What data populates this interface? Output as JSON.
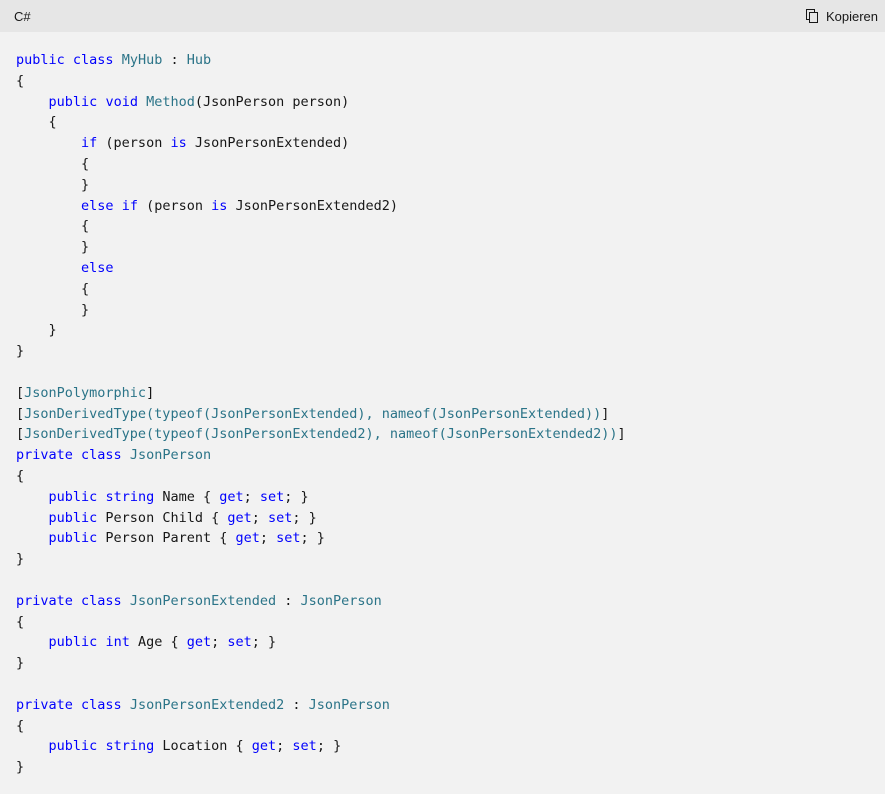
{
  "header": {
    "language": "C#",
    "copy_label": "Kopieren",
    "copy_icon": "copy-icon"
  },
  "colors": {
    "keyword": "#0101fd",
    "type": "#2b7488",
    "text": "#171717",
    "background": "#f2f2f2",
    "header_background": "#e6e6e6"
  },
  "code_lines": [
    [
      [
        "kw",
        "public"
      ],
      [
        "pl",
        " "
      ],
      [
        "kw",
        "class"
      ],
      [
        "pl",
        " "
      ],
      [
        "ty",
        "MyHub"
      ],
      [
        "pl",
        " : "
      ],
      [
        "ty",
        "Hub"
      ]
    ],
    [
      [
        "pl",
        "{"
      ]
    ],
    [
      [
        "pl",
        "    "
      ],
      [
        "kw",
        "public"
      ],
      [
        "pl",
        " "
      ],
      [
        "kw",
        "void"
      ],
      [
        "pl",
        " "
      ],
      [
        "ty",
        "Method"
      ],
      [
        "pl",
        "(JsonPerson person)"
      ]
    ],
    [
      [
        "pl",
        "    {"
      ]
    ],
    [
      [
        "pl",
        "        "
      ],
      [
        "kw",
        "if"
      ],
      [
        "pl",
        " (person "
      ],
      [
        "kw",
        "is"
      ],
      [
        "pl",
        " JsonPersonExtended)"
      ]
    ],
    [
      [
        "pl",
        "        {"
      ]
    ],
    [
      [
        "pl",
        "        }"
      ]
    ],
    [
      [
        "pl",
        "        "
      ],
      [
        "kw",
        "else"
      ],
      [
        "pl",
        " "
      ],
      [
        "kw",
        "if"
      ],
      [
        "pl",
        " (person "
      ],
      [
        "kw",
        "is"
      ],
      [
        "pl",
        " JsonPersonExtended2)"
      ]
    ],
    [
      [
        "pl",
        "        {"
      ]
    ],
    [
      [
        "pl",
        "        }"
      ]
    ],
    [
      [
        "pl",
        "        "
      ],
      [
        "kw",
        "else"
      ]
    ],
    [
      [
        "pl",
        "        {"
      ]
    ],
    [
      [
        "pl",
        "        }"
      ]
    ],
    [
      [
        "pl",
        "    }"
      ]
    ],
    [
      [
        "pl",
        "}"
      ]
    ],
    [
      [
        "pl",
        ""
      ]
    ],
    [
      [
        "pl",
        "["
      ],
      [
        "ty",
        "JsonPolymorphic"
      ],
      [
        "pl",
        "]"
      ]
    ],
    [
      [
        "pl",
        "["
      ],
      [
        "ty",
        "JsonDerivedType(typeof(JsonPersonExtended), nameof(JsonPersonExtended))"
      ],
      [
        "pl",
        "]"
      ]
    ],
    [
      [
        "pl",
        "["
      ],
      [
        "ty",
        "JsonDerivedType(typeof(JsonPersonExtended2), nameof(JsonPersonExtended2))"
      ],
      [
        "pl",
        "]"
      ]
    ],
    [
      [
        "kw",
        "private"
      ],
      [
        "pl",
        " "
      ],
      [
        "kw",
        "class"
      ],
      [
        "pl",
        " "
      ],
      [
        "ty",
        "JsonPerson"
      ]
    ],
    [
      [
        "pl",
        "{"
      ]
    ],
    [
      [
        "pl",
        "    "
      ],
      [
        "kw",
        "public"
      ],
      [
        "pl",
        " "
      ],
      [
        "kw",
        "string"
      ],
      [
        "pl",
        " Name { "
      ],
      [
        "kw",
        "get"
      ],
      [
        "pl",
        "; "
      ],
      [
        "kw",
        "set"
      ],
      [
        "pl",
        "; }"
      ]
    ],
    [
      [
        "pl",
        "    "
      ],
      [
        "kw",
        "public"
      ],
      [
        "pl",
        " Person Child { "
      ],
      [
        "kw",
        "get"
      ],
      [
        "pl",
        "; "
      ],
      [
        "kw",
        "set"
      ],
      [
        "pl",
        "; }"
      ]
    ],
    [
      [
        "pl",
        "    "
      ],
      [
        "kw",
        "public"
      ],
      [
        "pl",
        " Person Parent { "
      ],
      [
        "kw",
        "get"
      ],
      [
        "pl",
        "; "
      ],
      [
        "kw",
        "set"
      ],
      [
        "pl",
        "; }"
      ]
    ],
    [
      [
        "pl",
        "}"
      ]
    ],
    [
      [
        "pl",
        ""
      ]
    ],
    [
      [
        "kw",
        "private"
      ],
      [
        "pl",
        " "
      ],
      [
        "kw",
        "class"
      ],
      [
        "pl",
        " "
      ],
      [
        "ty",
        "JsonPersonExtended"
      ],
      [
        "pl",
        " : "
      ],
      [
        "ty",
        "JsonPerson"
      ]
    ],
    [
      [
        "pl",
        "{"
      ]
    ],
    [
      [
        "pl",
        "    "
      ],
      [
        "kw",
        "public"
      ],
      [
        "pl",
        " "
      ],
      [
        "kw",
        "int"
      ],
      [
        "pl",
        " Age { "
      ],
      [
        "kw",
        "get"
      ],
      [
        "pl",
        "; "
      ],
      [
        "kw",
        "set"
      ],
      [
        "pl",
        "; }"
      ]
    ],
    [
      [
        "pl",
        "}"
      ]
    ],
    [
      [
        "pl",
        ""
      ]
    ],
    [
      [
        "kw",
        "private"
      ],
      [
        "pl",
        " "
      ],
      [
        "kw",
        "class"
      ],
      [
        "pl",
        " "
      ],
      [
        "ty",
        "JsonPersonExtended2"
      ],
      [
        "pl",
        " : "
      ],
      [
        "ty",
        "JsonPerson"
      ]
    ],
    [
      [
        "pl",
        "{"
      ]
    ],
    [
      [
        "pl",
        "    "
      ],
      [
        "kw",
        "public"
      ],
      [
        "pl",
        " "
      ],
      [
        "kw",
        "string"
      ],
      [
        "pl",
        " Location { "
      ],
      [
        "kw",
        "get"
      ],
      [
        "pl",
        "; "
      ],
      [
        "kw",
        "set"
      ],
      [
        "pl",
        "; }"
      ]
    ],
    [
      [
        "pl",
        "}"
      ]
    ]
  ]
}
